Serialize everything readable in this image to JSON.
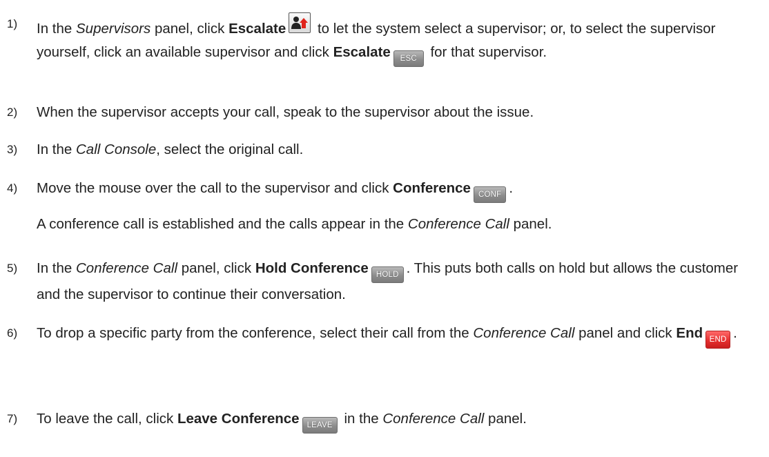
{
  "steps": [
    {
      "num": "1)",
      "a": "In the ",
      "b": "Supervisors",
      "c": " panel, click ",
      "d": "Escalate",
      "e": " to let the system select a supervisor; or, to select the supervisor yourself, click an available supervisor and click ",
      "f": "Escalate",
      "g": " for that supervisor.",
      "btn": "ESC"
    },
    {
      "num": "2)",
      "a": "When the supervisor accepts your call, speak to the supervisor about the issue."
    },
    {
      "num": "3)",
      "a": "In the ",
      "b": "Call Console",
      "c": ", select the original call."
    },
    {
      "num": "4)",
      "a": "Move the mouse over the call to the supervisor and click ",
      "b": "Conference",
      "c": ".",
      "btn": "CONF",
      "sub_a": "A conference call is established and the calls appear in the ",
      "sub_b": "Conference Call",
      "sub_c": " panel."
    },
    {
      "num": "5)",
      "a": "In the ",
      "b": "Conference Call",
      "c": " panel, click ",
      "d": "Hold Conference",
      "e": ".  This puts both calls on hold but allows the customer and the supervisor to continue their conversation.",
      "btn": "HOLD"
    },
    {
      "num": "6)",
      "a": "To drop a specific party from the conference, select their call from the ",
      "b": "Conference Call",
      "c": " panel and click ",
      "d": "End",
      "e": ".",
      "btn": "END"
    },
    {
      "num": "7)",
      "a": "To leave the call, click ",
      "b": "Leave Conference",
      "c": " in the ",
      "d": "Conference Call",
      "e": " panel.",
      "btn": "LEAVE"
    }
  ],
  "icons": {
    "escalate": "person-up-arrow-icon"
  },
  "colors": {
    "gray_button": "#8d8d8d",
    "red_button": "#e63030",
    "escalate_arrow": "#e0231b"
  }
}
